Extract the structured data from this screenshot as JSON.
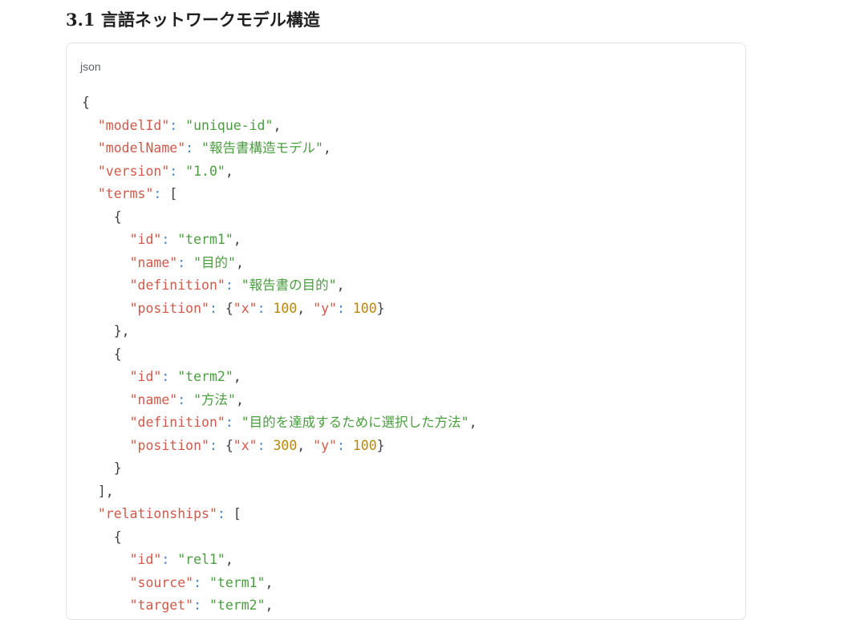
{
  "heading": "3.1 言語ネットワークモデル構造",
  "code_block": {
    "language": "json",
    "lines": [
      [
        {
          "t": "p",
          "v": "{"
        }
      ],
      [
        {
          "t": "p",
          "v": "  "
        },
        {
          "t": "k",
          "v": "\"modelId\""
        },
        {
          "t": "c",
          "v": ": "
        },
        {
          "t": "s",
          "v": "\"unique-id\""
        },
        {
          "t": "p",
          "v": ","
        }
      ],
      [
        {
          "t": "p",
          "v": "  "
        },
        {
          "t": "k",
          "v": "\"modelName\""
        },
        {
          "t": "c",
          "v": ": "
        },
        {
          "t": "s",
          "v": "\"報告書構造モデル\""
        },
        {
          "t": "p",
          "v": ","
        }
      ],
      [
        {
          "t": "p",
          "v": "  "
        },
        {
          "t": "k",
          "v": "\"version\""
        },
        {
          "t": "c",
          "v": ": "
        },
        {
          "t": "s",
          "v": "\"1.0\""
        },
        {
          "t": "p",
          "v": ","
        }
      ],
      [
        {
          "t": "p",
          "v": "  "
        },
        {
          "t": "k",
          "v": "\"terms\""
        },
        {
          "t": "c",
          "v": ": "
        },
        {
          "t": "p",
          "v": "["
        }
      ],
      [
        {
          "t": "p",
          "v": "    {"
        }
      ],
      [
        {
          "t": "p",
          "v": "      "
        },
        {
          "t": "k",
          "v": "\"id\""
        },
        {
          "t": "c",
          "v": ": "
        },
        {
          "t": "s",
          "v": "\"term1\""
        },
        {
          "t": "p",
          "v": ","
        }
      ],
      [
        {
          "t": "p",
          "v": "      "
        },
        {
          "t": "k",
          "v": "\"name\""
        },
        {
          "t": "c",
          "v": ": "
        },
        {
          "t": "s",
          "v": "\"目的\""
        },
        {
          "t": "p",
          "v": ","
        }
      ],
      [
        {
          "t": "p",
          "v": "      "
        },
        {
          "t": "k",
          "v": "\"definition\""
        },
        {
          "t": "c",
          "v": ": "
        },
        {
          "t": "s",
          "v": "\"報告書の目的\""
        },
        {
          "t": "p",
          "v": ","
        }
      ],
      [
        {
          "t": "p",
          "v": "      "
        },
        {
          "t": "k",
          "v": "\"position\""
        },
        {
          "t": "c",
          "v": ": "
        },
        {
          "t": "p",
          "v": "{"
        },
        {
          "t": "k",
          "v": "\"x\""
        },
        {
          "t": "c",
          "v": ": "
        },
        {
          "t": "n",
          "v": "100"
        },
        {
          "t": "p",
          "v": ", "
        },
        {
          "t": "k",
          "v": "\"y\""
        },
        {
          "t": "c",
          "v": ": "
        },
        {
          "t": "n",
          "v": "100"
        },
        {
          "t": "p",
          "v": "}"
        }
      ],
      [
        {
          "t": "p",
          "v": "    },"
        }
      ],
      [
        {
          "t": "p",
          "v": "    {"
        }
      ],
      [
        {
          "t": "p",
          "v": "      "
        },
        {
          "t": "k",
          "v": "\"id\""
        },
        {
          "t": "c",
          "v": ": "
        },
        {
          "t": "s",
          "v": "\"term2\""
        },
        {
          "t": "p",
          "v": ","
        }
      ],
      [
        {
          "t": "p",
          "v": "      "
        },
        {
          "t": "k",
          "v": "\"name\""
        },
        {
          "t": "c",
          "v": ": "
        },
        {
          "t": "s",
          "v": "\"方法\""
        },
        {
          "t": "p",
          "v": ","
        }
      ],
      [
        {
          "t": "p",
          "v": "      "
        },
        {
          "t": "k",
          "v": "\"definition\""
        },
        {
          "t": "c",
          "v": ": "
        },
        {
          "t": "s",
          "v": "\"目的を達成するために選択した方法\""
        },
        {
          "t": "p",
          "v": ","
        }
      ],
      [
        {
          "t": "p",
          "v": "      "
        },
        {
          "t": "k",
          "v": "\"position\""
        },
        {
          "t": "c",
          "v": ": "
        },
        {
          "t": "p",
          "v": "{"
        },
        {
          "t": "k",
          "v": "\"x\""
        },
        {
          "t": "c",
          "v": ": "
        },
        {
          "t": "n",
          "v": "300"
        },
        {
          "t": "p",
          "v": ", "
        },
        {
          "t": "k",
          "v": "\"y\""
        },
        {
          "t": "c",
          "v": ": "
        },
        {
          "t": "n",
          "v": "100"
        },
        {
          "t": "p",
          "v": "}"
        }
      ],
      [
        {
          "t": "p",
          "v": "    }"
        }
      ],
      [
        {
          "t": "p",
          "v": "  ],"
        }
      ],
      [
        {
          "t": "p",
          "v": "  "
        },
        {
          "t": "k",
          "v": "\"relationships\""
        },
        {
          "t": "c",
          "v": ": "
        },
        {
          "t": "p",
          "v": "["
        }
      ],
      [
        {
          "t": "p",
          "v": "    {"
        }
      ],
      [
        {
          "t": "p",
          "v": "      "
        },
        {
          "t": "k",
          "v": "\"id\""
        },
        {
          "t": "c",
          "v": ": "
        },
        {
          "t": "s",
          "v": "\"rel1\""
        },
        {
          "t": "p",
          "v": ","
        }
      ],
      [
        {
          "t": "p",
          "v": "      "
        },
        {
          "t": "k",
          "v": "\"source\""
        },
        {
          "t": "c",
          "v": ": "
        },
        {
          "t": "s",
          "v": "\"term1\""
        },
        {
          "t": "p",
          "v": ","
        }
      ],
      [
        {
          "t": "p",
          "v": "      "
        },
        {
          "t": "k",
          "v": "\"target\""
        },
        {
          "t": "c",
          "v": ": "
        },
        {
          "t": "s",
          "v": "\"term2\""
        },
        {
          "t": "p",
          "v": ","
        }
      ]
    ]
  },
  "colors": {
    "key": "#d0584a",
    "string": "#4a9d3f",
    "number": "#b8860b",
    "colon": "#4a86c7",
    "punctuation": "#3c4043"
  }
}
